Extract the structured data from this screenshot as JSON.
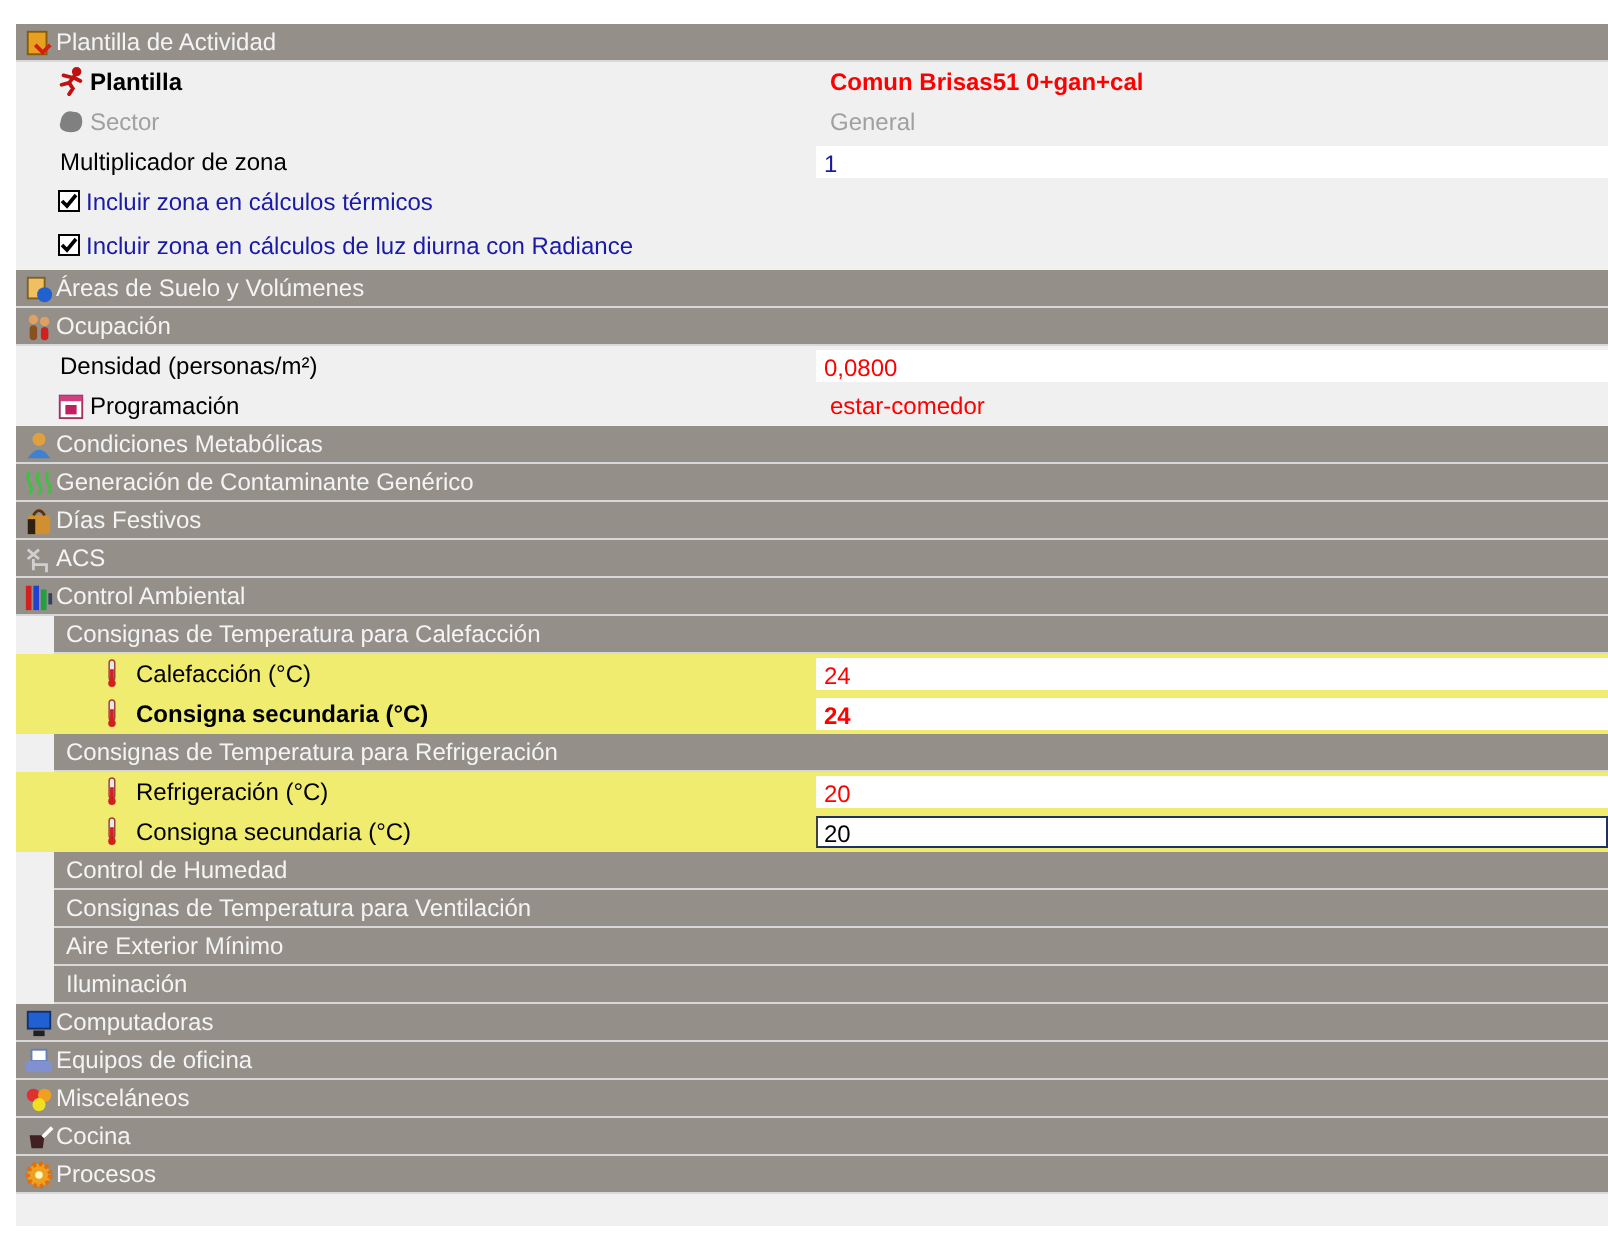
{
  "rows": [
    {
      "kind": "section",
      "label": "Plantilla de Actividad"
    },
    {
      "kind": "field",
      "label": "Plantilla",
      "bold": true,
      "disabled": false,
      "highlighted": false,
      "boxed": false,
      "value": "Comun Brisas51 0+gan+cal",
      "color": "#ff0000"
    },
    {
      "kind": "field",
      "label": "Sector",
      "bold": false,
      "disabled": true,
      "highlighted": false,
      "boxed": false,
      "value": "General",
      "color": "#a0a0a0"
    },
    {
      "kind": "field",
      "label": "Multiplicador de zona",
      "bold": false,
      "disabled": false,
      "highlighted": false,
      "boxed": true,
      "focused": false,
      "value": "1",
      "color": "#1a1aa0"
    },
    {
      "kind": "checkbox",
      "label": "Incluir zona en cálculos térmicos",
      "checked": true
    },
    {
      "kind": "checkbox",
      "label": "Incluir zona en cálculos de luz diurna con Radiance",
      "checked": true
    },
    {
      "kind": "section",
      "label": "Áreas de Suelo y Volúmenes"
    },
    {
      "kind": "section",
      "label": "Ocupación"
    },
    {
      "kind": "field",
      "label": "Densidad (personas/m²)",
      "bold": false,
      "disabled": false,
      "highlighted": false,
      "boxed": true,
      "focused": false,
      "value": "0,0800",
      "color": "#ff0000"
    },
    {
      "kind": "field",
      "label": "Programación",
      "bold": false,
      "disabled": false,
      "highlighted": false,
      "boxed": false,
      "value": "estar-comedor",
      "color": "#ff0000"
    },
    {
      "kind": "section",
      "label": "Condiciones Metabólicas"
    },
    {
      "kind": "section",
      "label": "Generación de Contaminante Genérico"
    },
    {
      "kind": "section",
      "label": "Días Festivos"
    },
    {
      "kind": "section",
      "label": "ACS"
    },
    {
      "kind": "section",
      "label": "Control Ambiental"
    },
    {
      "kind": "subsection",
      "label": "Consignas de Temperatura para Calefacción"
    },
    {
      "kind": "field",
      "label": "Calefacción (°C)",
      "bold": false,
      "disabled": false,
      "highlighted": true,
      "boxed": true,
      "focused": false,
      "value": "24",
      "color": "#ff0000"
    },
    {
      "kind": "field",
      "label": "Consigna secundaria (°C)",
      "bold": true,
      "disabled": false,
      "highlighted": true,
      "boxed": true,
      "focused": false,
      "value": "24",
      "color": "#ff0000"
    },
    {
      "kind": "subsection",
      "label": "Consignas de Temperatura para Refrigeración"
    },
    {
      "kind": "field",
      "label": "Refrigeración (°C)",
      "bold": false,
      "disabled": false,
      "highlighted": true,
      "boxed": true,
      "focused": false,
      "value": "20",
      "color": "#ff0000"
    },
    {
      "kind": "field",
      "label": "Consigna secundaria (°C)",
      "bold": false,
      "disabled": false,
      "highlighted": true,
      "boxed": true,
      "focused": true,
      "value": "20",
      "color": "#000000"
    },
    {
      "kind": "subsection",
      "label": "Control de Humedad"
    },
    {
      "kind": "subsection",
      "label": "Consignas de Temperatura para Ventilación"
    },
    {
      "kind": "subsection",
      "label": "Aire Exterior Mínimo"
    },
    {
      "kind": "subsection",
      "label": "Iluminación"
    },
    {
      "kind": "section",
      "label": "Computadoras"
    },
    {
      "kind": "section",
      "label": "Equipos de oficina"
    },
    {
      "kind": "section",
      "label": "Misceláneos"
    },
    {
      "kind": "section",
      "label": "Cocina"
    },
    {
      "kind": "section",
      "label": "Procesos"
    }
  ]
}
